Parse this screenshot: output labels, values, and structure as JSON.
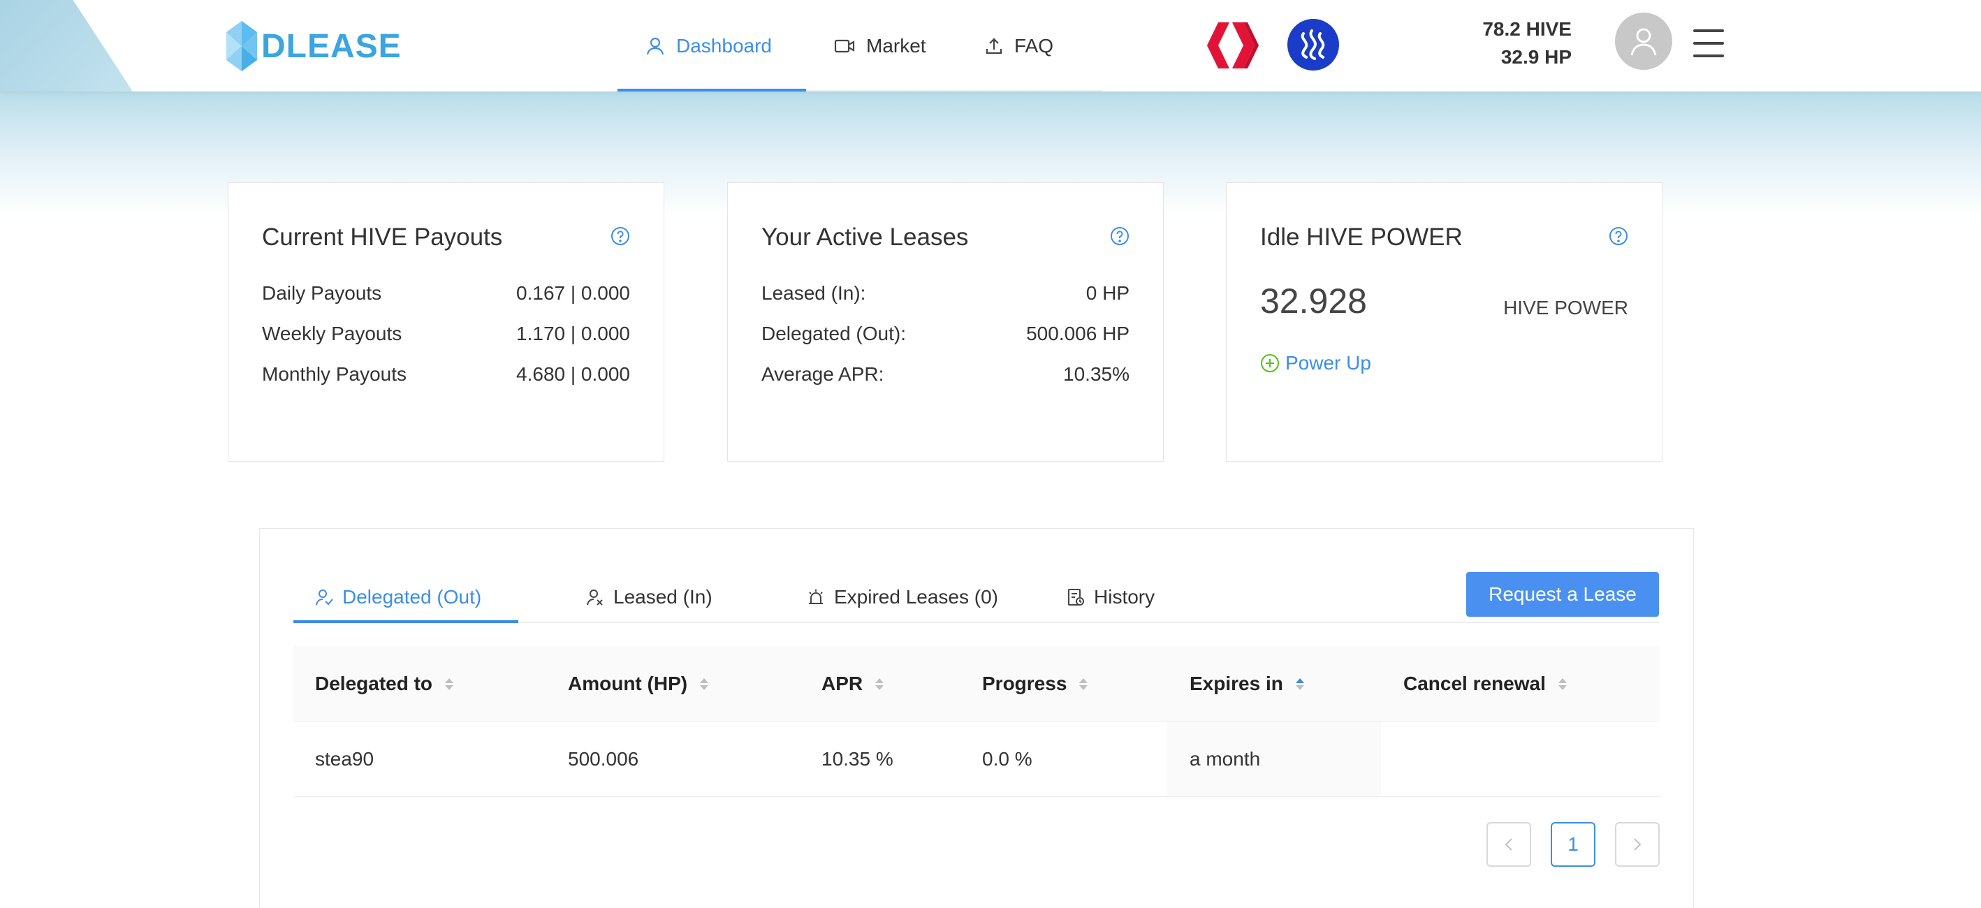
{
  "brand": {
    "name": "DLEASE",
    "color": "#3aa5e0"
  },
  "nav": {
    "items": [
      {
        "label": "Dashboard",
        "icon": "user-icon",
        "active": true
      },
      {
        "label": "Market",
        "icon": "video-icon"
      },
      {
        "label": "FAQ",
        "icon": "upload-icon"
      }
    ]
  },
  "account": {
    "hive_balance": "78.2 HIVE",
    "hp_balance": "32.9 HP"
  },
  "cards": {
    "payouts": {
      "title": "Current HIVE Payouts",
      "rows": [
        {
          "label": "Daily Payouts",
          "value": "0.167 | 0.000"
        },
        {
          "label": "Weekly Payouts",
          "value": "1.170 | 0.000"
        },
        {
          "label": "Monthly Payouts",
          "value": "4.680 | 0.000"
        }
      ]
    },
    "leases": {
      "title": "Your Active Leases",
      "rows": [
        {
          "label": "Leased (In):",
          "value": "0 HP"
        },
        {
          "label": "Delegated (Out):",
          "value": "500.006 HP"
        },
        {
          "label": "Average APR:",
          "value": "10.35%"
        }
      ]
    },
    "idle": {
      "title": "Idle HIVE POWER",
      "amount": "32.928",
      "unit": "HIVE POWER",
      "action_label": "Power Up"
    }
  },
  "tabs": [
    {
      "label": "Delegated (Out)",
      "icon": "user-delegate-icon",
      "active": true
    },
    {
      "label": "Leased (In)",
      "icon": "user-lease-icon"
    },
    {
      "label": "Expired Leases (0)",
      "icon": "alarm-icon"
    },
    {
      "label": "History",
      "icon": "history-icon"
    }
  ],
  "request_button_label": "Request a Lease",
  "table": {
    "columns": [
      "Delegated to",
      "Amount (HP)",
      "APR",
      "Progress",
      "Expires in",
      "Cancel renewal"
    ],
    "sorted_column": "Expires in",
    "rows": [
      {
        "delegated_to": "stea90",
        "amount": "500.006",
        "apr": "10.35 %",
        "progress": "0.0 %",
        "expires": "a month",
        "cancel": ""
      }
    ]
  },
  "pagination": {
    "current_page": "1",
    "prev": "<",
    "next": ">"
  },
  "colors": {
    "accent": "#3b8ee8",
    "hive_red": "#e31337",
    "steem_blue": "#1a3cc8",
    "power_up_green": "#52c41a"
  }
}
